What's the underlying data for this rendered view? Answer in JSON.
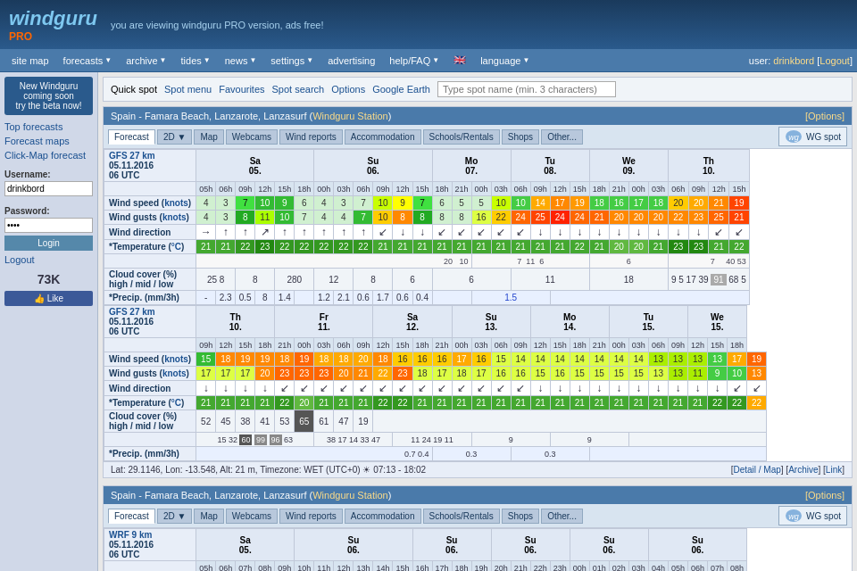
{
  "header": {
    "logo": "windguru",
    "logo_sub": "PRO",
    "message": "you are viewing windguru PRO version, ads free!",
    "flag": "🇬🇧"
  },
  "navbar": {
    "items": [
      "site map",
      "forecasts",
      "archive",
      "tides",
      "news",
      "settings",
      "advertising",
      "help/FAQ",
      "language"
    ],
    "user_label": "user:",
    "username": "drinkbord",
    "logout": "Logout"
  },
  "sidebar": {
    "promo_title": "New Windguru coming soon",
    "promo_sub": "try the beta now!",
    "top_forecasts": "Top forecasts",
    "forecast_maps": "Forecast maps",
    "click_map": "Click-Map forecast",
    "username_label": "Username:",
    "password_label": "Password:",
    "login_btn": "Login",
    "logout_link": "Logout",
    "fans": "73K",
    "like": "Like"
  },
  "quickspot": {
    "label": "Quick spot",
    "links": [
      "Spot menu",
      "Favourites",
      "Spot search",
      "Options",
      "Google Earth"
    ],
    "input_placeholder": "Type spot name (min. 3 characters)"
  },
  "section1": {
    "title": "Spain - Famara Beach, Lanzarote, Lanzasurf",
    "station_link": "Windguru Station",
    "options_link": "Options",
    "tabs": [
      "Forecast",
      "2D",
      "Map",
      "Webcams",
      "Wind reports",
      "Accommodation",
      "Schools/Rentals",
      "Shops",
      "Other..."
    ],
    "wg_spot": "WG spot",
    "model1": {
      "name": "GFS 27 km",
      "date": "05.11.2016",
      "utc": "06 UTC"
    },
    "lat": "Lat: 29.1146, Lon: -13.548, Alt: 21 m, Timezone: WET (UTC+0)",
    "time_local": "07:13 - 18:02",
    "detail_link": "Detail / Map",
    "archive_link": "Archive",
    "link_link": "Link"
  },
  "section2": {
    "title": "Spain - Famara Beach, Lanzarote, Lanzasurf",
    "station_link": "Windguru Station",
    "options_link": "Options",
    "tabs": [
      "Forecast",
      "2D",
      "Map",
      "Webcams",
      "Wind reports",
      "Accommodation",
      "Schools/Rentals",
      "Shops",
      "Other..."
    ],
    "wg_spot": "WG spot",
    "model1": {
      "name": "WRF 9 km",
      "date": "05.11.2016",
      "utc": "06 UTC"
    }
  }
}
